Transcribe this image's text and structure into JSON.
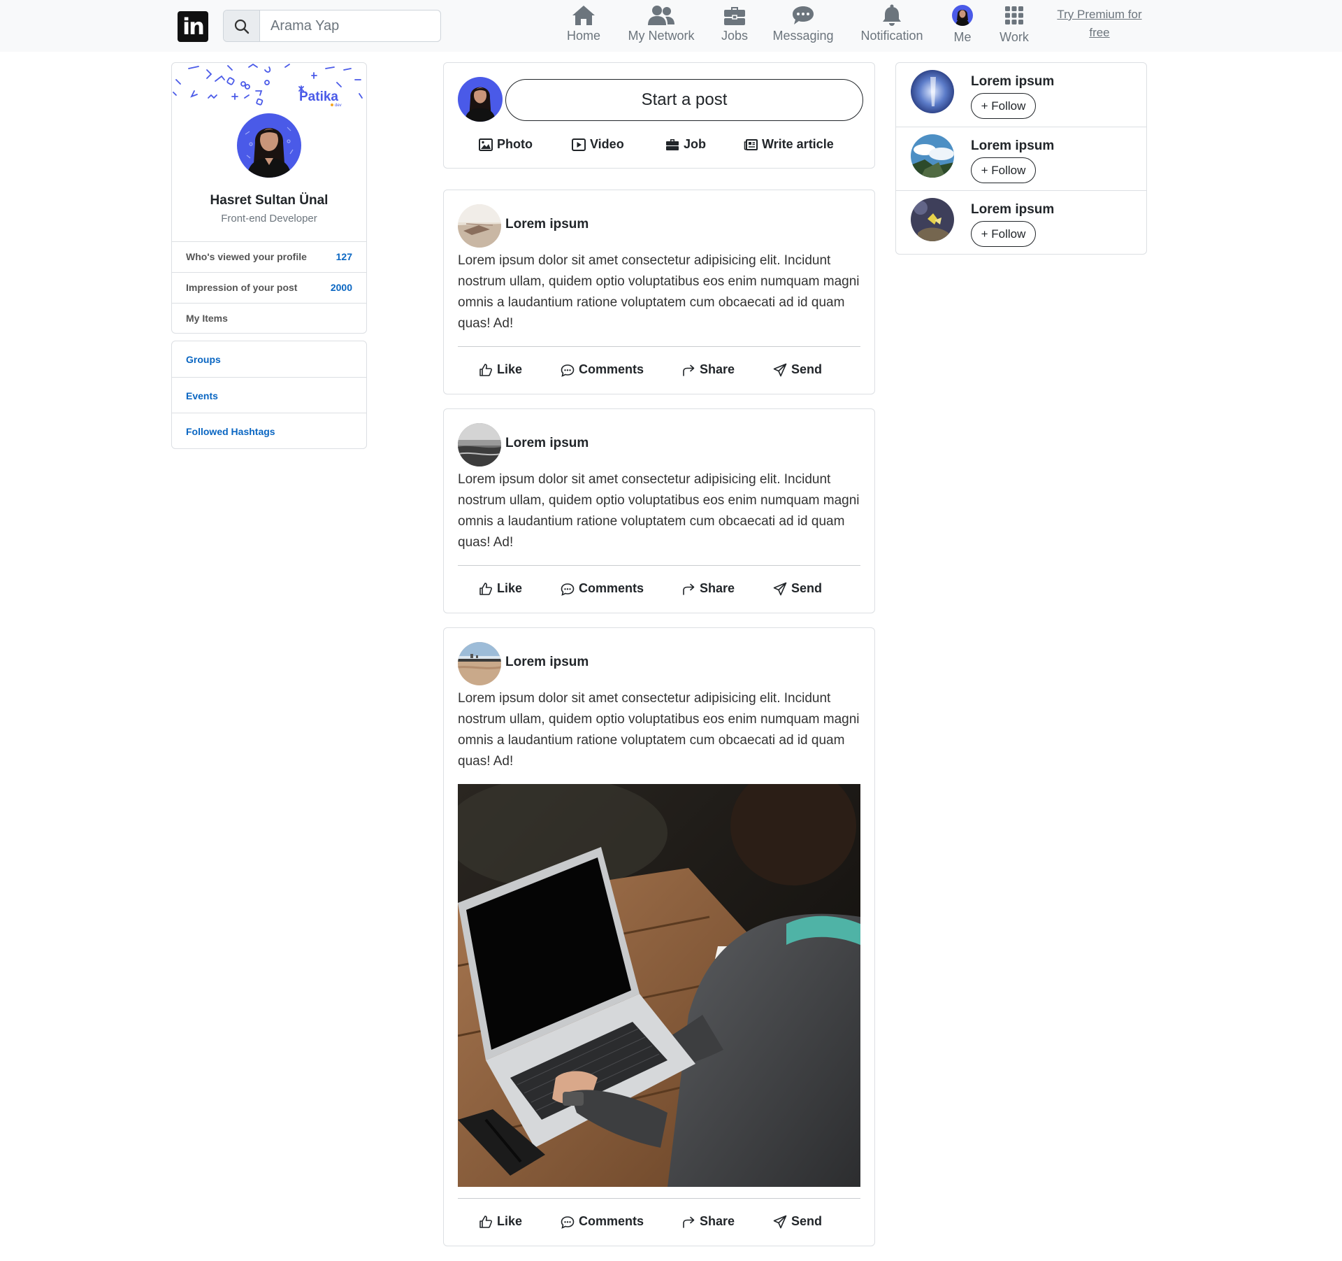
{
  "nav": {
    "logo_text": "in",
    "search_placeholder": "Arama Yap",
    "items": [
      {
        "label": "Home",
        "icon": "home-icon"
      },
      {
        "label": "My Network",
        "icon": "users-icon"
      },
      {
        "label": "Jobs",
        "icon": "briefcase-icon"
      },
      {
        "label": "Messaging",
        "icon": "chat-icon"
      },
      {
        "label": "Notification",
        "icon": "bell-icon"
      },
      {
        "label": "Me",
        "icon": "avatar"
      },
      {
        "label": "Work",
        "icon": "grid-icon"
      }
    ],
    "premium_line1": "Try Premium for",
    "premium_line2": "free"
  },
  "profile": {
    "banner_brand": "Patika",
    "banner_brand_sub": "dev",
    "name": "Hasret Sultan Ünal",
    "role": "Front-end Developer",
    "stats": [
      {
        "label": "Who's viewed your profile",
        "value": "127"
      },
      {
        "label": "Impression of your post",
        "value": "2000"
      },
      {
        "label": "My Items",
        "value": ""
      }
    ],
    "links": [
      "Groups",
      "Events",
      "Followed Hashtags"
    ]
  },
  "composer": {
    "placeholder": "Start a post",
    "actions": [
      {
        "label": "Photo",
        "icon": "image-icon"
      },
      {
        "label": "Video",
        "icon": "video-icon"
      },
      {
        "label": "Job",
        "icon": "briefcase-icon"
      },
      {
        "label": "Write article",
        "icon": "newspaper-icon"
      }
    ]
  },
  "posts": [
    {
      "author": "Lorem ipsum",
      "text": "Lorem ipsum dolor sit amet consectetur adipisicing elit. Incidunt nostrum ullam, quidem optio voluptatibus eos enim numquam magni omnis a laudantium ratione voluptatem cum obcaecati ad id quam quas! Ad!"
    },
    {
      "author": "Lorem ipsum",
      "text": "Lorem ipsum dolor sit amet consectetur adipisicing elit. Incidunt nostrum ullam, quidem optio voluptatibus eos enim numquam magni omnis a laudantium ratione voluptatem cum obcaecati ad id quam quas! Ad!"
    },
    {
      "author": "Lorem ipsum",
      "text": "Lorem ipsum dolor sit amet consectetur adipisicing elit. Incidunt nostrum ullam, quidem optio voluptatibus eos enim numquam magni omnis a laudantium ratione voluptatem cum obcaecati ad id quam quas! Ad!"
    }
  ],
  "post_actions": {
    "like": "Like",
    "comments": "Comments",
    "share": "Share",
    "send": "Send"
  },
  "suggestions": [
    {
      "name": "Lorem ipsum",
      "button": "+ Follow"
    },
    {
      "name": "Lorem ipsum",
      "button": "+ Follow"
    },
    {
      "name": "Lorem ipsum",
      "button": "+ Follow"
    }
  ],
  "colors": {
    "accent": "#0a66c2",
    "nav_bg": "#f8f9fa",
    "avatar_bg": "#4a5ae8"
  }
}
